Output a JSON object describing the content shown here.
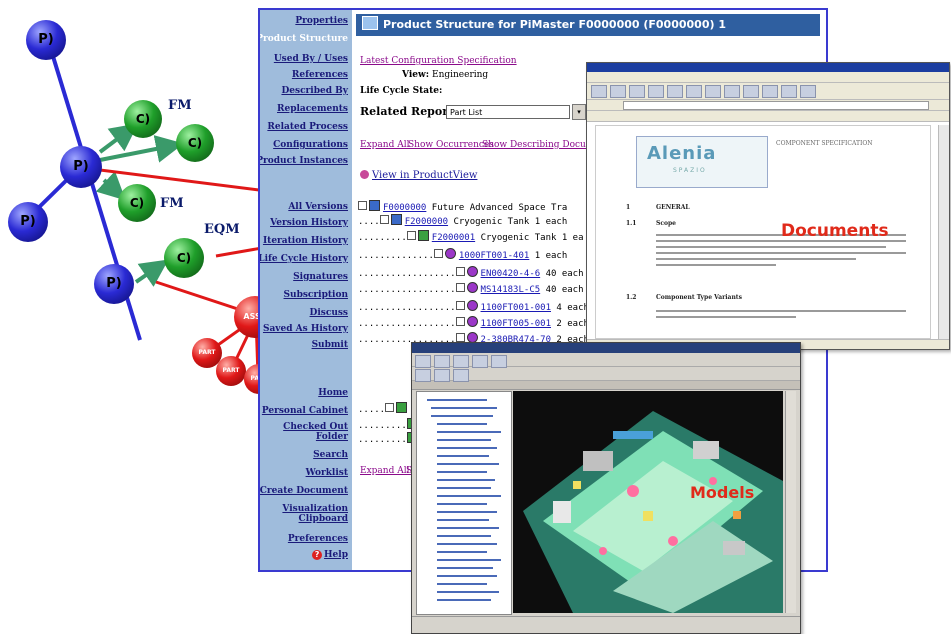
{
  "nodes": {
    "product": "P)",
    "component": "C)",
    "assembly": "ASSY",
    "part": "PART"
  },
  "node_labels": {
    "fm1": "FM",
    "fm2": "FM",
    "eqm": "EQM"
  },
  "colors": {
    "product_node": "#2323c8",
    "component_node": "#1e9a2a",
    "assembly_node": "#e01818",
    "link_arrow": "#e01818",
    "window_border": "#3a3ad0",
    "sidebar": "#9fbcdc",
    "callout_label": "#e02a1a"
  },
  "sidebar": {
    "items": [
      "Properties",
      "Product Structure",
      "Used By / Uses",
      "References",
      "Described By",
      "Replacements",
      "Related Process",
      "Configurations",
      "Product Instances",
      "All Versions",
      "Version History",
      "Iteration History",
      "Life Cycle History",
      "Signatures",
      "Subscription",
      "Discuss",
      "Saved As History",
      "Submit",
      "Home",
      "Personal Cabinet",
      "Checked Out Folder",
      "Search",
      "Worklist",
      "Create Document",
      "Visualization Clipboard",
      "Preferences",
      "Help"
    ]
  },
  "main_window": {
    "title": "Product Structure for PiMaster F0000000 (F0000000) 1",
    "latest_config_link": "Latest Configuration Specification",
    "view_label": "View:",
    "view_value": "Engineering",
    "lifecycle_label": "Life Cycle State:",
    "related_reports_label": "Related Reports:",
    "related_reports_value": "Part List",
    "expand_all": "Expand All",
    "show_occurrences": "Show Occurrences",
    "show_describing": "Show Describing Documents",
    "view_in_productview": "View in ProductView",
    "expand_all_bottom": "Expand All",
    "expand_all_bottom_more": "Sh",
    "tree": [
      {
        "id": "F0000000",
        "desc": "Future Advanced Space Tra"
      },
      {
        "id": "F2000000",
        "desc": "Cryogenic Tank 1 each"
      },
      {
        "id": "F2000001",
        "desc": "Cryogenic Tank 1 ea"
      },
      {
        "id": "1000FT001-401",
        "desc": "1 each"
      },
      {
        "id": "EN00420-4-6",
        "desc": "40 each"
      },
      {
        "id": "MS14183L-C5",
        "desc": "40 each"
      },
      {
        "id": "1100FT001-001",
        "desc": "4 each"
      },
      {
        "id": "1100FT005-001",
        "desc": "2 each"
      },
      {
        "id": "2-380BR474-70",
        "desc": "2 each"
      }
    ]
  },
  "documents_window": {
    "company_logo": "Alenia",
    "company_sub": "SPAZIO",
    "header_right": "COMPONENT SPECIFICATION",
    "sections": [
      {
        "num": "1",
        "title": "GENERAL"
      },
      {
        "num": "1.1",
        "title": "Scope"
      },
      {
        "num": "1.2",
        "title": "Component Type Variants"
      }
    ],
    "label": "Documents"
  },
  "models_window": {
    "label": "Models"
  }
}
